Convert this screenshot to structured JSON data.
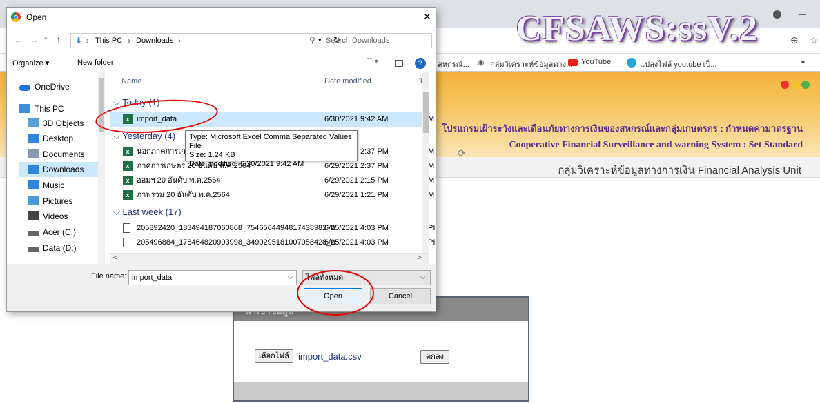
{
  "browser": {
    "bookmarks": [
      "สหกรณ์...",
      "กลุ่มวิเคราะห์ข้อมูลทาง...",
      "YouTube",
      "แปลงไฟล์ youtube เป็..."
    ],
    "more": "»"
  },
  "banner": {
    "title": "CFSAWS:ssV.2",
    "thai_line": "โปรแกรมเฝ้าระวังและเตือนภัยทางการเงินของสหกรณ์และกลุ่มเกษตรกร : กำหนดค่ามาตรฐาน",
    "english_line": "Cooperative Financial Surveillance and warning System : Set Standard",
    "unit": "กลุ่มวิเคราะห์ข้อมูลทางการเงิน  Financial Analysis Unit",
    "dot_colors": [
      "#e8322b",
      "#f5c22a",
      "#4bb34b"
    ]
  },
  "upload": {
    "header": "นำเข้าข้อมูล",
    "choose_button": "เลือกไฟล์",
    "file_name": "import_data.csv",
    "ok_button": "ตกลง"
  },
  "dialog": {
    "title": "Open",
    "close": "✕",
    "breadcrumb": [
      "This PC",
      "Downloads"
    ],
    "search_placeholder": "Search Downloads",
    "organize": "Organize ▾",
    "new_folder": "New folder",
    "nav": [
      {
        "label": "OneDrive",
        "icon": "cloud-icon",
        "color": "#1f73d3"
      },
      {
        "label": "This PC",
        "icon": "computer-icon",
        "color": "#3c8fd6"
      },
      {
        "label": "3D Objects",
        "icon": "cube-icon",
        "color": "#5aa0d8"
      },
      {
        "label": "Desktop",
        "icon": "desktop-icon",
        "color": "#2e86de"
      },
      {
        "label": "Documents",
        "icon": "document-icon",
        "color": "#8a9ab0"
      },
      {
        "label": "Downloads",
        "icon": "download-icon",
        "color": "#2e86de"
      },
      {
        "label": "Music",
        "icon": "music-icon",
        "color": "#2e86de"
      },
      {
        "label": "Pictures",
        "icon": "pictures-icon",
        "color": "#4a9ad8"
      },
      {
        "label": "Videos",
        "icon": "videos-icon",
        "color": "#444"
      },
      {
        "label": "Acer (C:)",
        "icon": "drive-icon",
        "color": "#666"
      },
      {
        "label": "Data (D:)",
        "icon": "drive-icon",
        "color": "#666"
      }
    ],
    "columns": {
      "name": "Name",
      "date": "Date modified",
      "type": "Ty"
    },
    "groups": {
      "today": "Today (1)",
      "yesterday": "Yesterday (4)",
      "last_week": "Last week (17)"
    },
    "files": [
      {
        "name": "import_data",
        "date": "6/30/2021 9:42 AM",
        "type": "M"
      },
      {
        "name": "นอกภาคการเกษตร 20 อันดับ พ.ค.2564",
        "date": "6/29/2021 2:37 PM",
        "type": "M"
      },
      {
        "name": "ภาคการเกษตร 20 อันดับ พ.ค.2564",
        "date": "6/29/2021 2:37 PM",
        "type": "M"
      },
      {
        "name": "ออมฯ 20 อันดับ พ.ค.2564",
        "date": "6/29/2021 2:15 PM",
        "type": "M"
      },
      {
        "name": "ภาพรวม 20 อันดับ พ.ค.2564",
        "date": "6/29/2021 1:21 PM",
        "type": "M"
      },
      {
        "name": "205892420_183494187060868_7546564494817438982_n",
        "date": "6/25/2021 4:03 PM",
        "type": "PI"
      },
      {
        "name": "205496884_178464820903998_3490295181007058428_n",
        "date": "6/25/2021 4:03 PM",
        "type": "PI"
      }
    ],
    "tooltip": {
      "type": "Type: Microsoft Excel Comma Separated Values File",
      "size": "Size: 1.24 KB",
      "date": "Date modified: 6/30/2021 9:42 AM"
    },
    "file_name_label": "File name:",
    "file_name_value": "import_data",
    "filter": "ไฟล์ทั้งหมด",
    "open_button": "Open",
    "cancel_button": "Cancel"
  }
}
